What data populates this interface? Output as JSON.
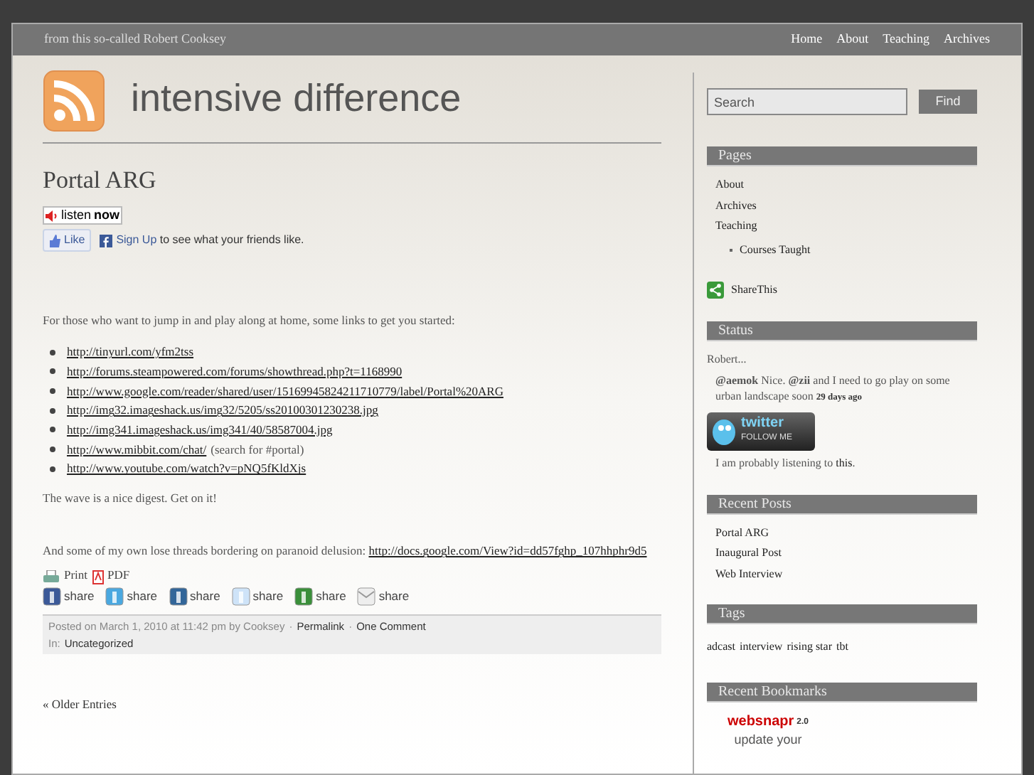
{
  "top_bar": {
    "tagline": "from this so-called Robert Cooksey",
    "nav": [
      {
        "label": "Home"
      },
      {
        "label": "About"
      },
      {
        "label": "Teaching"
      },
      {
        "label": "Archives"
      }
    ]
  },
  "header": {
    "title": "intensive difference"
  },
  "search": {
    "placeholder": "Search",
    "button": "Find"
  },
  "post": {
    "title": "Portal ARG",
    "listen": {
      "plain": "listen",
      "bold": "now"
    },
    "like": {
      "button": "Like",
      "link": "Sign Up",
      "text": "to see what your friends like."
    },
    "intro": "For those who want to jump in and play along at home, some links to get you started:",
    "links": [
      {
        "url": "http://tinyurl.com/yfm2tss"
      },
      {
        "url": "http://forums.steampowered.com/forums/showthread.php?t=1168990"
      },
      {
        "url": "http://www.google.com/reader/shared/user/15169945824211710779/label/Portal%20ARG"
      },
      {
        "url": "http://img32.imageshack.us/img32/5205/ss20100301230238.jpg"
      },
      {
        "url": "http://img341.imageshack.us/img341/40/58587004.jpg"
      },
      {
        "url": "http://www.mibbit.com/chat/",
        "note": "(search for #portal)"
      },
      {
        "url": "http://www.youtube.com/watch?v=pNQ5fKldXjs"
      }
    ],
    "wave": "The wave is a nice digest. Get on it!",
    "threads": {
      "text": "And some of my own lose threads bordering on paranoid delusion:",
      "url": "http://docs.google.com/View?id=dd57fghp_107hhphr9d5"
    },
    "print": "Print",
    "pdf": "PDF",
    "shares": [
      {
        "kind": "facebook",
        "label": "share"
      },
      {
        "kind": "twitter",
        "label": "share"
      },
      {
        "kind": "digg",
        "label": "share"
      },
      {
        "kind": "reddit",
        "label": "share"
      },
      {
        "kind": "stumble",
        "label": "share"
      },
      {
        "kind": "email",
        "label": "share"
      }
    ],
    "meta": {
      "posted": "Posted on March 1, 2010 at 11:42 pm by Cooksey",
      "sep": "·",
      "permalink": "Permalink",
      "comments": "One Comment",
      "in": "In:",
      "category": "Uncategorized"
    }
  },
  "older": "« Older Entries",
  "sidebar": {
    "pages": {
      "heading": "Pages",
      "items": [
        {
          "label": "About"
        },
        {
          "label": "Archives"
        },
        {
          "label": "Teaching",
          "children": [
            {
              "label": "Courses Taught"
            }
          ]
        }
      ]
    },
    "sharethis": "ShareThis",
    "status": {
      "heading": "Status",
      "author": "Robert...",
      "tweet": "**@aemok** Nice. **@zii** and I need to go play on some urban landscape soon",
      "age": "29 days ago",
      "badge_top": "twitter",
      "badge_bottom": "FOLLOW ME",
      "listening": "I am probably listening to",
      "listening_link": "this",
      "listening_end": "."
    },
    "recent_posts": {
      "heading": "Recent Posts",
      "items": [
        {
          "label": "Portal ARG"
        },
        {
          "label": "Inaugural Post"
        },
        {
          "label": "Web Interview"
        }
      ]
    },
    "tags": {
      "heading": "Tags",
      "items": [
        {
          "label": "adcast"
        },
        {
          "label": "interview"
        },
        {
          "label": "rising star"
        },
        {
          "label": "tbt"
        }
      ]
    },
    "bookmarks": {
      "heading": "Recent Bookmarks",
      "brand": "websnapr",
      "version": "2.0",
      "line": "update your"
    }
  }
}
